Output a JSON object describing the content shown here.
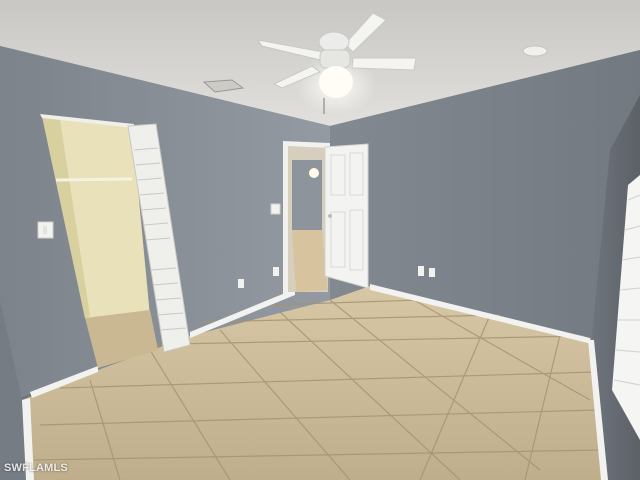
{
  "photo": {
    "subject": "empty-bedroom",
    "watermark": "SWFLAMLS"
  },
  "colors": {
    "ceiling": "#dcdad6",
    "wall_left": "#8c929a",
    "wall_back": "#7d838b",
    "wall_right": "#6c7279",
    "floor": "#cdbb98",
    "grout": "#9f8e70",
    "baseboard": "#f2f2f0",
    "door": "#f3f3f1",
    "closet_interior": "#ece6bf",
    "hallway": "#dcd4c0"
  },
  "icons": [
    "ceiling-fan-icon",
    "light-switch-icon",
    "outlet-icon",
    "smoke-detector-icon",
    "air-vent-icon"
  ]
}
